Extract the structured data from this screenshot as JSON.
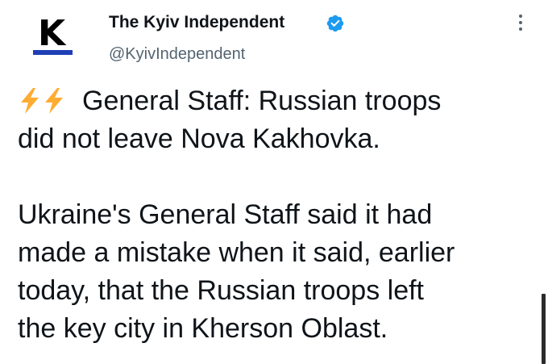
{
  "author": {
    "name": "The Kyiv Independent",
    "handle": "@KyivIndependent",
    "avatar_letter": "K",
    "avatar_bar_color": "#1f3fb5",
    "verified_color": "#1d9bf0"
  },
  "tweet": {
    "headline_emoji": "⚡⚡",
    "line1": "General Staff: Russian troops",
    "line2": "did not leave Nova Kakhovka.",
    "line3": "Ukraine's General Staff said it had",
    "line4": "made a mistake when it said, earlier",
    "line5": "today, that the Russian troops left",
    "line6": "the key city in Kherson Oblast."
  },
  "icons": {
    "verified": "verified-badge-icon",
    "more": "more-options-icon",
    "bolt": "high-voltage-icon"
  },
  "colors": {
    "text": "#0f1419",
    "secondary": "#536471",
    "bolt_fill": "#ffac33"
  }
}
